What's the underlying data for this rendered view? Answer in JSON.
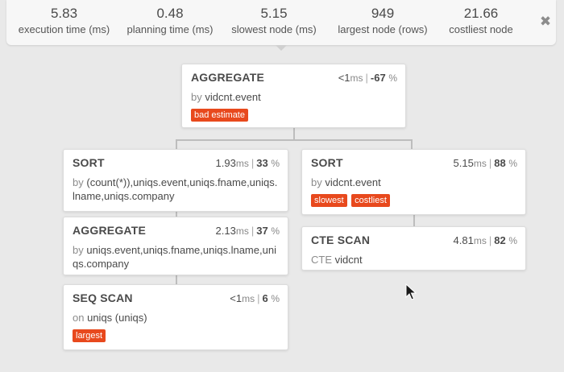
{
  "stats": [
    {
      "value": "5.83",
      "label": "execution time (ms)"
    },
    {
      "value": "0.48",
      "label": "planning time (ms)"
    },
    {
      "value": "5.15",
      "label": "slowest node (ms)"
    },
    {
      "value": "949",
      "label": "largest node (rows)"
    },
    {
      "value": "21.66",
      "label": "costliest node"
    }
  ],
  "close_glyph": "✖",
  "nodes": {
    "aggregate_root": {
      "type": "AGGREGATE",
      "duration": "<1",
      "unit": "ms",
      "percent": "-67",
      "pct_sign": "%",
      "prefix": "by",
      "detail": "vidcnt.event",
      "tags": [
        "bad estimate"
      ]
    },
    "sort_left": {
      "type": "SORT",
      "duration": "1.93",
      "unit": "ms",
      "percent": "33",
      "pct_sign": "%",
      "prefix": "by",
      "detail": "(count(*)),uniqs.event,uniqs.fname,uniqs.lname,uniqs.company",
      "tags": []
    },
    "aggregate_left": {
      "type": "AGGREGATE",
      "duration": "2.13",
      "unit": "ms",
      "percent": "37",
      "pct_sign": "%",
      "prefix": "by",
      "detail": "uniqs.event,uniqs.fname,uniqs.lname,uniqs.company",
      "tags": []
    },
    "seq_scan": {
      "type": "SEQ SCAN",
      "duration": "<1",
      "unit": "ms",
      "percent": "6",
      "pct_sign": "%",
      "prefix": "on",
      "detail": "uniqs (uniqs)",
      "tags": [
        "largest"
      ]
    },
    "sort_right": {
      "type": "SORT",
      "duration": "5.15",
      "unit": "ms",
      "percent": "88",
      "pct_sign": "%",
      "prefix": "by",
      "detail": "vidcnt.event",
      "tags": [
        "slowest",
        "costliest"
      ]
    },
    "cte_scan": {
      "type": "CTE SCAN",
      "duration": "4.81",
      "unit": "ms",
      "percent": "82",
      "pct_sign": "%",
      "prefix": "CTE",
      "detail": "vidcnt",
      "tags": []
    }
  },
  "colors": {
    "tag": "#e8491d",
    "background": "#e9e9e9",
    "card": "#ffffff",
    "connector": "#bdbdbd"
  }
}
